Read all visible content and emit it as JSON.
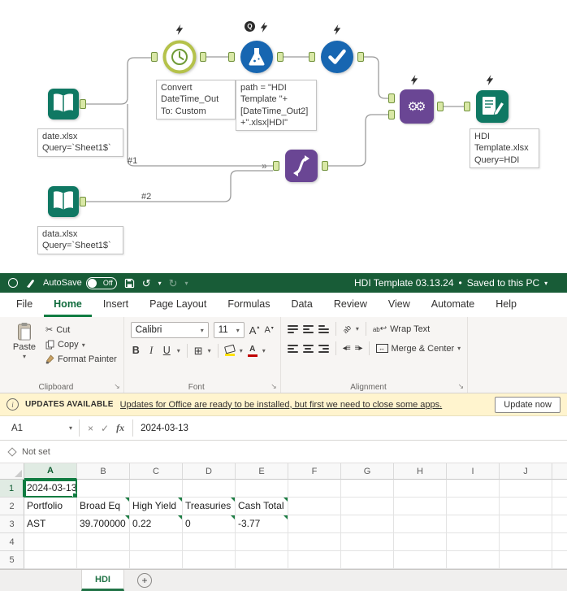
{
  "workflow": {
    "input_date": {
      "file": "date.xlsx",
      "query": "Query=`Sheet1$`"
    },
    "input_data": {
      "file": "data.xlsx",
      "query": "Query=`Sheet1$`"
    },
    "datetime_annotation": "Convert DateTime_Out To: Custom",
    "formula_annotation": "path = \"HDI Template \"+[DateTime_Out2]+\".xlsx|HDI\"",
    "formula_badge": "Q",
    "multi_input_marker": "»",
    "wire_label_1": "#1",
    "wire_label_2": "#2",
    "output": {
      "file": "HDI Template.xlsx",
      "query": "Query=HDI"
    }
  },
  "excel": {
    "titlebar": {
      "autosave_label": "AutoSave",
      "autosave_state": "Off",
      "title": "HDI Template 03.13.24",
      "separator": "•",
      "saved_status": "Saved to this PC"
    },
    "tabs": [
      "File",
      "Home",
      "Insert",
      "Page Layout",
      "Formulas",
      "Data",
      "Review",
      "View",
      "Automate",
      "Help"
    ],
    "ribbon": {
      "paste": "Paste",
      "cut": "Cut",
      "copy": "Copy",
      "format_painter": "Format Painter",
      "clipboard_group": "Clipboard",
      "font_name": "Calibri",
      "font_size": "11",
      "bold": "B",
      "italic": "I",
      "underline": "U",
      "grow_font": "A",
      "shrink_font": "A",
      "font_color_label": "A",
      "font_group": "Font",
      "wrap_text": "Wrap Text",
      "merge_center": "Merge & Center",
      "alignment_group": "Alignment"
    },
    "message_bar": {
      "badge": "UPDATES AVAILABLE",
      "message": "Updates for Office are ready to be installed, but first we need to close some apps.",
      "action": "Update now"
    },
    "formula_bar": {
      "name_box": "A1",
      "fx": "fx",
      "value": "2024-03-13"
    },
    "sensitivity_label": "Not set",
    "grid": {
      "columns": [
        "A",
        "B",
        "C",
        "D",
        "E",
        "F",
        "G",
        "H",
        "I",
        "J"
      ],
      "rows": [
        "1",
        "2",
        "3",
        "4",
        "5"
      ],
      "cells": {
        "A1": "2024-03-13",
        "A2": "Portfolio",
        "B2": "Broad Eq",
        "C2": "High Yield",
        "D2": "Treasuries",
        "E2": "Cash Total",
        "A3": "AST",
        "B3": "39.700000",
        "C3": "0.22",
        "D3": "0",
        "E3": "-3.77"
      }
    },
    "sheet_tab": "HDI"
  },
  "icons": {
    "chevron_down": "▾",
    "caret_up": "▴",
    "scissors": "✂",
    "undo": "↺",
    "redo": "↻",
    "gears": "⚙⚙",
    "check": "✓",
    "close": "×",
    "borders": "⊞",
    "ab": "ab",
    "wrap_return": "↩",
    "merge_arrows": "↔",
    "launcher": "↘",
    "info": "i",
    "plus": "+",
    "indent_left": "◂≡",
    "indent_right": "≡▸"
  },
  "colors": {
    "excel_green": "#185c37",
    "accent_green": "#107c41",
    "alteryx_teal": "#0f7863",
    "alteryx_blue": "#1766b1",
    "alteryx_purple": "#6a4694",
    "message_bar_yellow": "#fff4ce",
    "anchor_green": "#d9e8a6"
  }
}
